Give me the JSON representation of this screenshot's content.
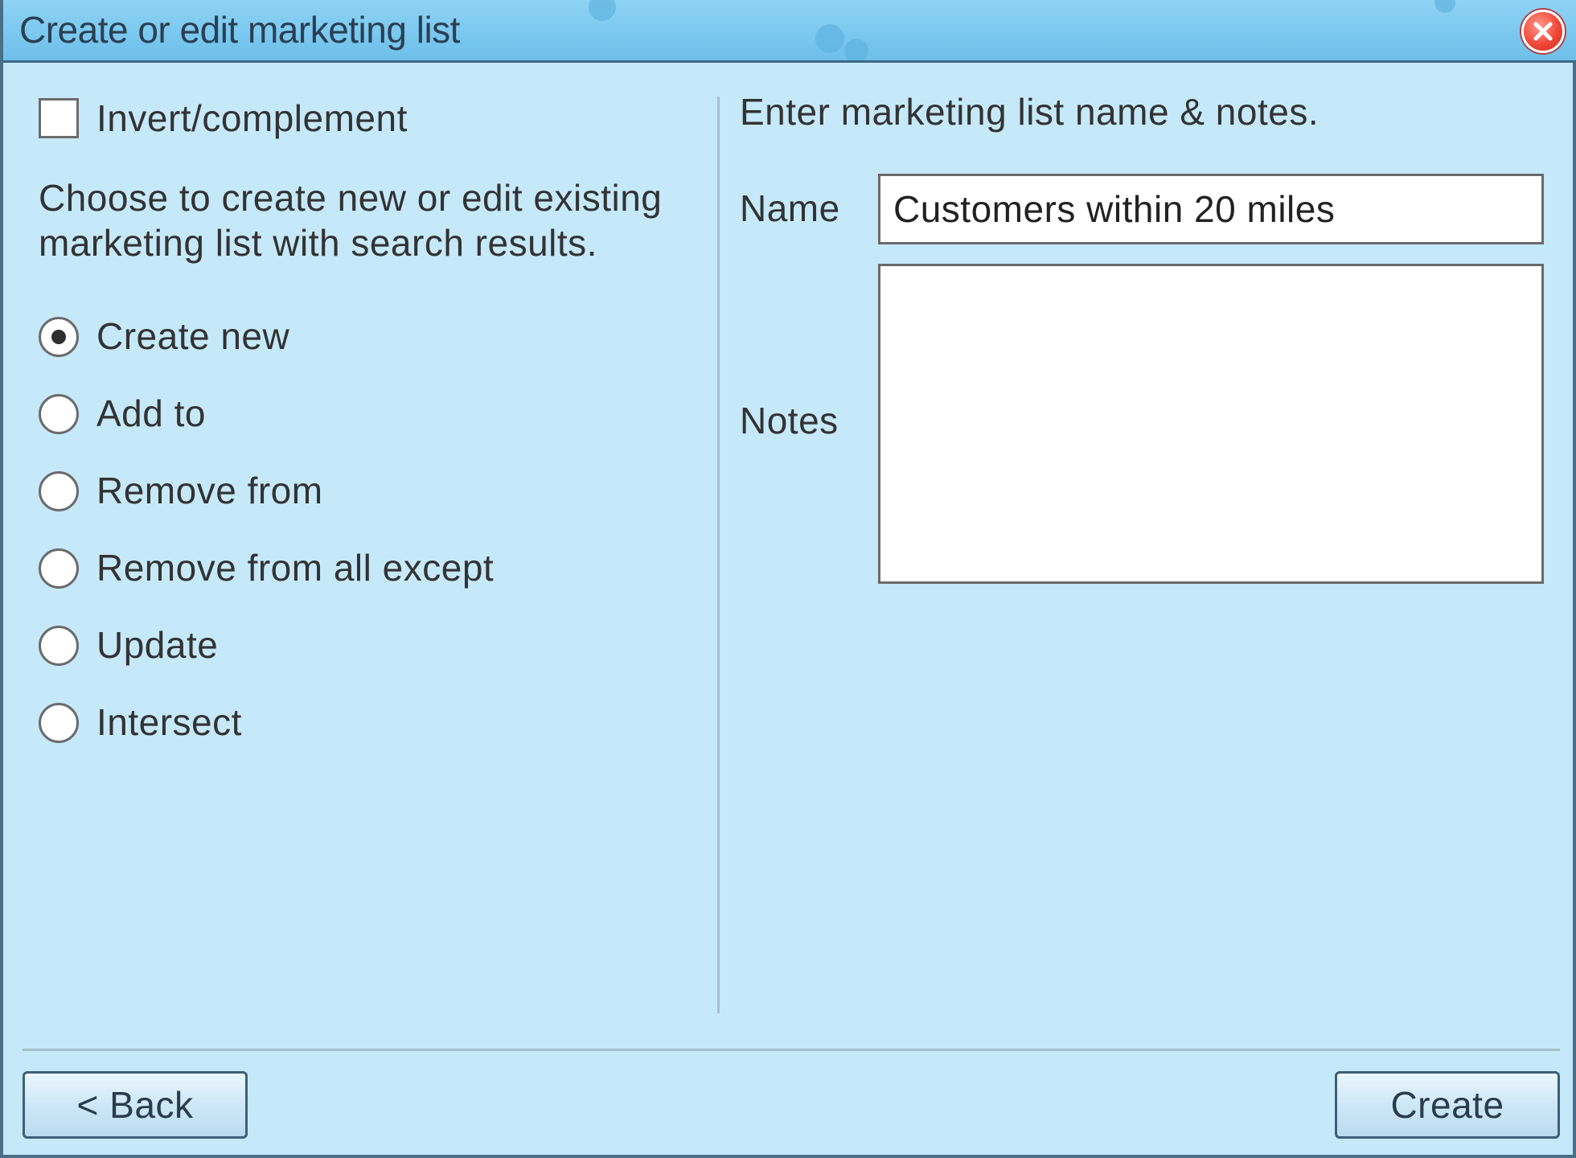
{
  "dialog": {
    "title": "Create or edit marketing list"
  },
  "left": {
    "invert_label": "Invert/complement",
    "invert_checked": false,
    "description": "Choose to create new or edit existing marketing list with search results.",
    "options": [
      {
        "label": "Create new",
        "selected": true
      },
      {
        "label": "Add to",
        "selected": false
      },
      {
        "label": "Remove from",
        "selected": false
      },
      {
        "label": "Remove from all except",
        "selected": false
      },
      {
        "label": "Update",
        "selected": false
      },
      {
        "label": "Intersect",
        "selected": false
      }
    ]
  },
  "right": {
    "heading": "Enter marketing list name & notes.",
    "name_label": "Name",
    "name_value": "Customers within 20 miles",
    "notes_label": "Notes",
    "notes_value": ""
  },
  "footer": {
    "back_label": "< Back",
    "create_label": "Create"
  },
  "colors": {
    "dialog_background": "#c6e9fa",
    "titlebar": "#79c7ef",
    "close_button": "#f0493a"
  },
  "icons": {
    "close": "close-icon"
  }
}
